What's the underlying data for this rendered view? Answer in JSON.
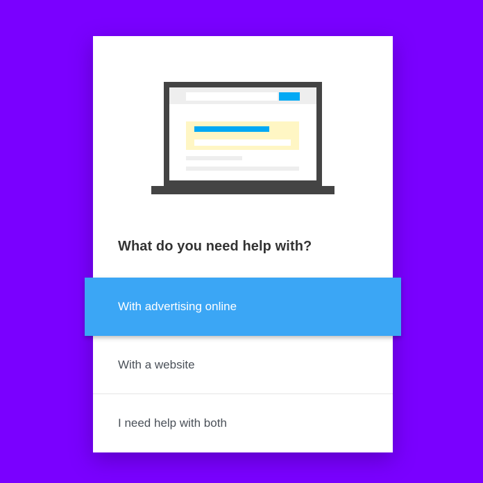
{
  "prompt": {
    "question": "What do you need help with?"
  },
  "options": [
    {
      "label": "With advertising online",
      "selected": true
    },
    {
      "label": "With a website",
      "selected": false
    },
    {
      "label": "I need help with both",
      "selected": false
    }
  ],
  "colors": {
    "background": "#7a00ff",
    "card": "#ffffff",
    "selected": "#3ba6f5",
    "text": "#333333",
    "option_text": "#4a5058"
  },
  "illustration": {
    "icon": "laptop-icon"
  }
}
